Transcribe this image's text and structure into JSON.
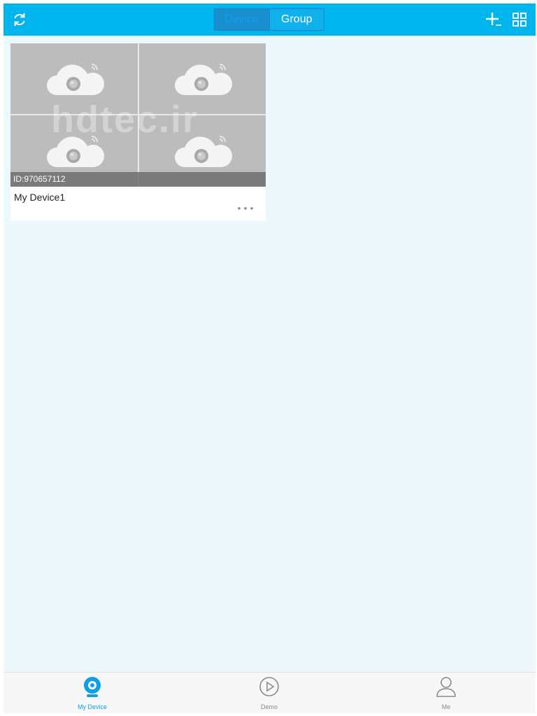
{
  "header": {
    "refresh_icon": "refresh-icon",
    "tabs": [
      {
        "label": "Device",
        "active": true
      },
      {
        "label": "Group",
        "active": false
      }
    ],
    "add_icon": "plus-icon",
    "layout_icon": "grid-icon"
  },
  "devices": [
    {
      "name": "My Device1",
      "id_label": "ID:970657112",
      "preview_icon": "cloud-camera-icon",
      "more_icon": "more-dots-icon"
    }
  ],
  "watermark": "hdtec.ir",
  "bottom_nav": [
    {
      "label": "My Device",
      "icon": "camera-icon",
      "active": true
    },
    {
      "label": "Demo",
      "icon": "play-icon",
      "active": false
    },
    {
      "label": "Me",
      "icon": "user-icon",
      "active": false
    }
  ],
  "colors": {
    "accent": "#00b4ee",
    "background": "#eef8fc",
    "tab_active": "#1a8fd0",
    "nav_active": "#0f9fe6"
  }
}
